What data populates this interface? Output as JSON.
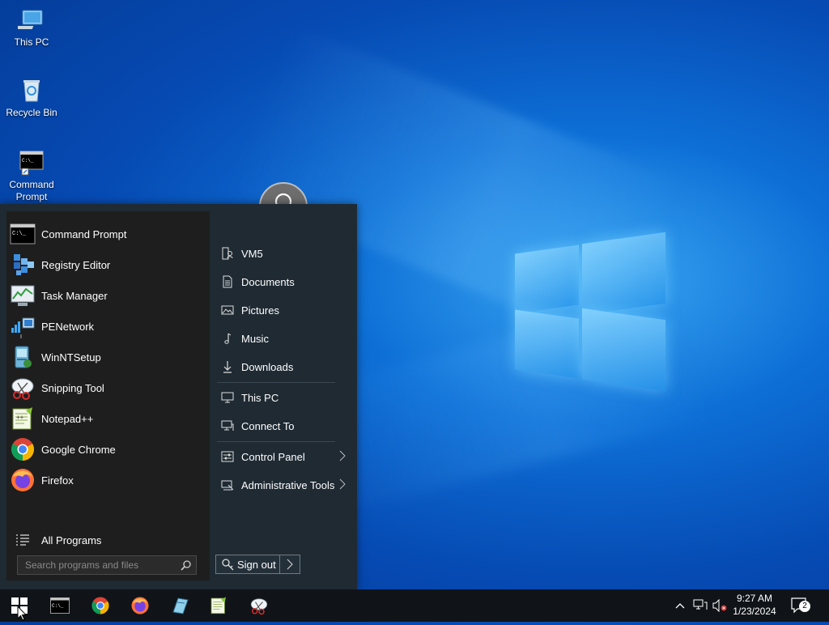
{
  "desktop": {
    "icons": [
      {
        "label": "This PC",
        "icon": "computer-icon"
      },
      {
        "label": "Recycle Bin",
        "icon": "recycle-bin-icon"
      },
      {
        "label": "Command Prompt",
        "icon": "command-prompt-icon"
      }
    ]
  },
  "start_menu": {
    "programs": [
      {
        "label": "Command Prompt",
        "icon": "command-prompt-icon"
      },
      {
        "label": "Registry Editor",
        "icon": "registry-editor-icon"
      },
      {
        "label": "Task Manager",
        "icon": "task-manager-icon"
      },
      {
        "label": "PENetwork",
        "icon": "network-icon"
      },
      {
        "label": "WinNTSetup",
        "icon": "setup-icon"
      },
      {
        "label": "Snipping Tool",
        "icon": "snipping-tool-icon"
      },
      {
        "label": "Notepad++",
        "icon": "notepad-plus-plus-icon"
      },
      {
        "label": "Google Chrome",
        "icon": "chrome-icon"
      },
      {
        "label": "Firefox",
        "icon": "firefox-icon"
      }
    ],
    "all_programs_label": "All Programs",
    "search_placeholder": "Search programs and files",
    "right_items": [
      {
        "label": "VM5",
        "icon": "user-folder-icon"
      },
      {
        "label": "Documents",
        "icon": "document-icon"
      },
      {
        "label": "Pictures",
        "icon": "picture-icon"
      },
      {
        "label": "Music",
        "icon": "music-note-icon"
      },
      {
        "label": "Downloads",
        "icon": "download-arrow-icon"
      },
      {
        "label": "This PC",
        "icon": "computer-icon"
      },
      {
        "label": "Connect To",
        "icon": "connect-icon"
      },
      {
        "label": "Control Panel",
        "icon": "control-panel-icon"
      },
      {
        "label": "Administrative Tools",
        "icon": "admin-tools-icon"
      }
    ],
    "sign_out_label": "Sign out"
  },
  "taskbar": {
    "pinned": [
      "command-prompt-icon",
      "chrome-icon",
      "firefox-icon",
      "setup-icon",
      "notepad-plus-plus-icon",
      "snipping-tool-icon"
    ],
    "time": "9:27 AM",
    "date": "1/23/2024",
    "notification_count": "2"
  }
}
